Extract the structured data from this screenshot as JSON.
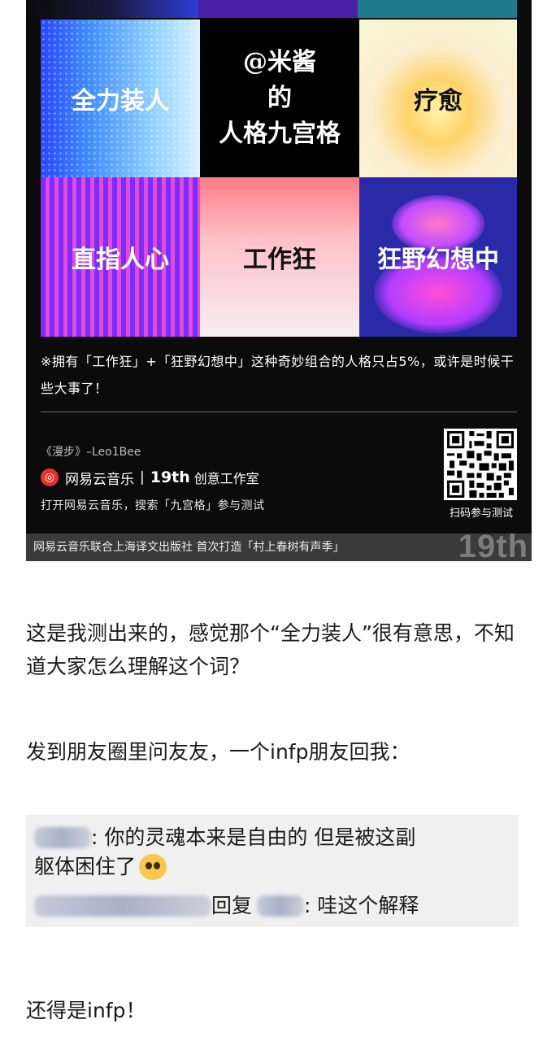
{
  "post_image": {
    "grid_title": "@米酱\n的\n人格九宫格",
    "cells": [
      {
        "label": "全力装人"
      },
      {
        "label": "疗愈"
      },
      {
        "label": "直指人心"
      },
      {
        "label": "工作狂"
      },
      {
        "label": "狂野幻想中"
      }
    ],
    "note": "※拥有「工作狂」+「狂野幻想中」这种奇妙组合的人格只占5%，或许是时候干些大事了！",
    "song": "《漫步》–Leo1Bee",
    "brand_name": "网易云音乐",
    "brand_tag": "19th",
    "brand_studio": "创意工作室",
    "instruction": "打开网易云音乐，搜索「九宫格」参与测试",
    "qr_caption": "扫码参与测试",
    "caption": "网易云音乐联合上海译文出版社 首次打造「村上春树有声季」",
    "caption_watermark": "19th",
    "colors": {
      "card_bg": "#0b0b0b",
      "caption_bg": "#3a3a3a",
      "brand_red": "#e4322c"
    }
  },
  "paragraphs": {
    "p1": "这是我测出来的，感觉那个“全力装人”很有意思，不知道大家怎么理解这个词？",
    "p2": "发到朋友圈里问友友，一个infp朋友回我：",
    "p4": "还得是infp！"
  },
  "comments": {
    "c1_text": ": 你的灵魂本来是自由的  但是被这副",
    "c1_text2": "躯体困住了",
    "c1_emoji": "pleading-face-emoji",
    "c2_reply": "回复",
    "c2_text": ": 哇这个解释"
  }
}
